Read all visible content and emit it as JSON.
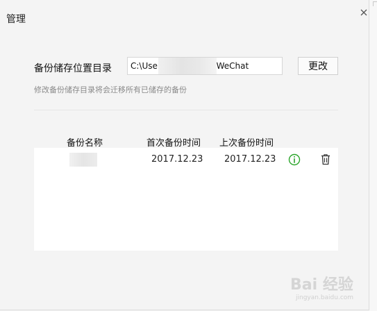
{
  "dialog": {
    "title": "管理",
    "close_icon": "close-icon"
  },
  "backup_dir": {
    "label": "备份储存位置目录",
    "path_value": "C:\\User        uments\\WeChat",
    "change_button": "更改",
    "hint": "修改备份储存目录将会迁移所有已储存的备份"
  },
  "table": {
    "columns": [
      "备份名称",
      "首次备份时间",
      "上次备份时间"
    ],
    "rows": [
      {
        "name": "",
        "first_backup": "2017.12.23",
        "last_backup": "2017.12.23",
        "actions": [
          "info-icon",
          "trash-icon"
        ]
      }
    ]
  },
  "watermark": {
    "logo": "Bai 经验",
    "sub": "jingyan.baidu.com"
  },
  "colors": {
    "info_green": "#2aa52a",
    "hint_gray": "#8a8a8a"
  }
}
